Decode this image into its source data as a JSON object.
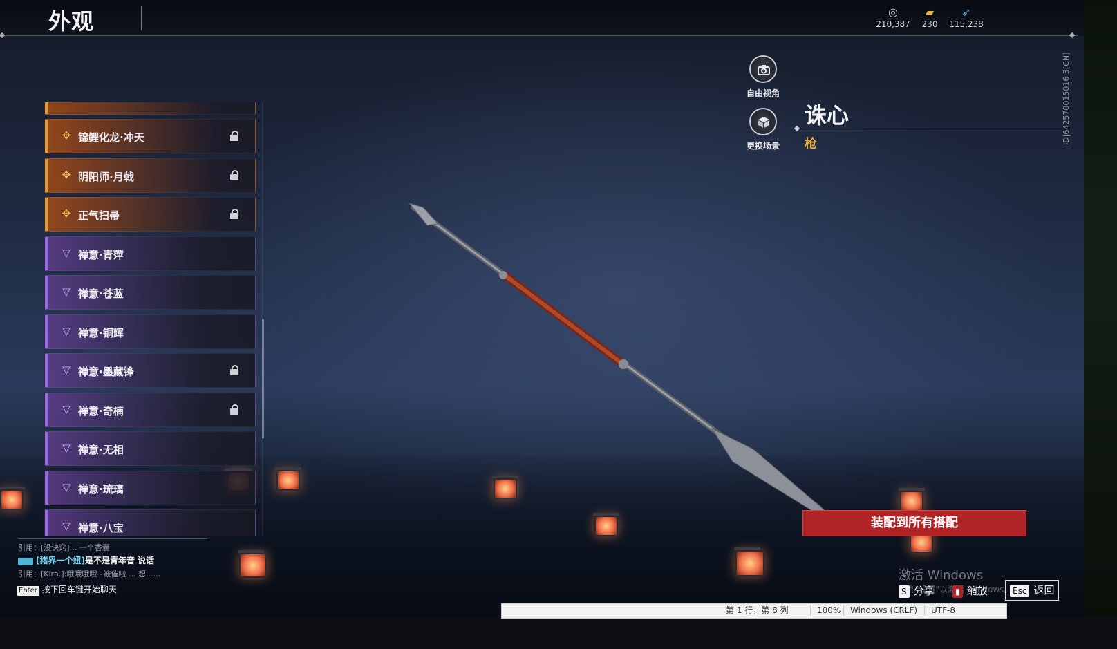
{
  "header": {
    "title": "外观",
    "currencies": [
      {
        "icon": "silver-coin-icon",
        "value": "210,387"
      },
      {
        "icon": "gold-ticket-icon",
        "value": "230"
      },
      {
        "icon": "blue-feather-icon",
        "value": "115,238"
      }
    ]
  },
  "side_id": "ID|642570015016 3[CN]",
  "list": {
    "items": [
      {
        "label": "锦鲤化龙·冲天",
        "rarity": "orange",
        "locked": true
      },
      {
        "label": "阴阳师·月戟",
        "rarity": "orange",
        "locked": true
      },
      {
        "label": "正气扫帚",
        "rarity": "orange",
        "locked": true
      },
      {
        "label": "禅意·青萍",
        "rarity": "purple",
        "locked": false
      },
      {
        "label": "禅意·苍蓝",
        "rarity": "purple",
        "locked": false
      },
      {
        "label": "禅意·铜辉",
        "rarity": "purple",
        "locked": false
      },
      {
        "label": "禅意·墨藏锋",
        "rarity": "purple",
        "locked": true
      },
      {
        "label": "禅意·奇楠",
        "rarity": "purple",
        "locked": true
      },
      {
        "label": "禅意·无相",
        "rarity": "purple",
        "locked": false
      },
      {
        "label": "禅意·琉璃",
        "rarity": "purple",
        "locked": false
      },
      {
        "label": "禅意·八宝",
        "rarity": "purple",
        "locked": false
      }
    ]
  },
  "camera": {
    "free_view_label": "自由视角",
    "change_scene_label": "更换场景"
  },
  "weapon": {
    "name": "诛心",
    "type": "枪"
  },
  "equip_button": "装配到所有搭配",
  "watermark": {
    "title": "激活 Windows",
    "subtitle": "转到\"设置\"以激活 Windows。"
  },
  "key_hints": {
    "share_key": "S",
    "share_label": "分享",
    "zoom_label": "缩放",
    "back_key": "Esc",
    "back_label": "返回"
  },
  "chat": {
    "line1": "引用：[没诀窍]... 一个香囊",
    "line2_name": "[猪界一个妞]",
    "line2_msg": "是不是青年音 说话",
    "line3": "引用：[Kira.]:哦哦哦哦~被催啦 ... 想......",
    "enter_key": "Enter",
    "enter_hint": "按下回车键开始聊天"
  },
  "editor_status": {
    "position": "第 1 行，第 8 列",
    "zoom": "100%",
    "line_ending": "Windows (CRLF)",
    "encoding": "UTF-8"
  },
  "colors": {
    "accent_red": "#b02426",
    "weapon_type": "#e6b04a",
    "orange_rarity": "#e09a3a",
    "purple_rarity": "#9a6ae0"
  }
}
